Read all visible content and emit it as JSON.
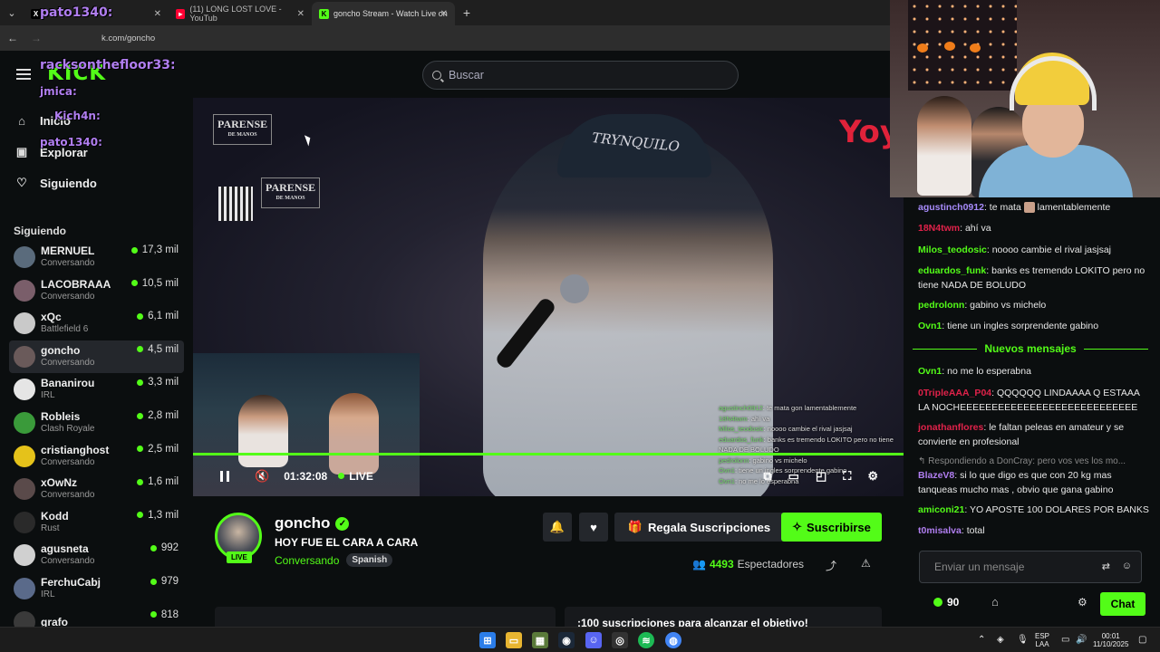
{
  "browser": {
    "tabs": [
      {
        "title": "",
        "favicon": "x-icon"
      },
      {
        "title": "(11) LONG LOST LOVE - YouTub",
        "favicon": "youtube-icon"
      },
      {
        "title": "goncho Stream - Watch Live on",
        "favicon": "kick-icon"
      }
    ],
    "url": "k.com/goncho"
  },
  "site": {
    "logo": "KICK",
    "search_placeholder": "Buscar"
  },
  "nav": {
    "home": "Inicio",
    "explore": "Explorar",
    "following": "Siguiendo"
  },
  "following_section": "Siguiendo",
  "channels": [
    {
      "name": "MERNUEL",
      "category": "Conversando",
      "viewers": "17,3 mil",
      "avatar_color": "#5a6b7c"
    },
    {
      "name": "LACOBRAAA",
      "category": "Conversando",
      "viewers": "10,5 mil",
      "avatar_color": "#7a5e6a"
    },
    {
      "name": "xQc",
      "category": "Battlefield 6",
      "viewers": "6,1 mil",
      "avatar_color": "#c9c9c9"
    },
    {
      "name": "goncho",
      "category": "Conversando",
      "viewers": "4,5 mil",
      "avatar_color": "#6a5a5a"
    },
    {
      "name": "Bananirou",
      "category": "IRL",
      "viewers": "3,3 mil",
      "avatar_color": "#e5e5e5"
    },
    {
      "name": "Robleis",
      "category": "Clash Royale",
      "viewers": "2,8 mil",
      "avatar_color": "#3a9a3a"
    },
    {
      "name": "cristianghost",
      "category": "Conversando",
      "viewers": "2,5 mil",
      "avatar_color": "#e5c21a"
    },
    {
      "name": "xOwNz",
      "category": "Conversando",
      "viewers": "1,6 mil",
      "avatar_color": "#5a4a4a"
    },
    {
      "name": "Kodd",
      "category": "Rust",
      "viewers": "1,3 mil",
      "avatar_color": "#2a2a2a"
    },
    {
      "name": "agusneta",
      "category": "Conversando",
      "viewers": "992",
      "avatar_color": "#d0d0d0"
    },
    {
      "name": "FerchuCabj",
      "category": "IRL",
      "viewers": "979",
      "avatar_color": "#5a6a8a"
    },
    {
      "name": "grafo",
      "category": "",
      "viewers": "818",
      "avatar_color": "#3a3a3a"
    }
  ],
  "video": {
    "time": "01:32:08",
    "live_label": "LIVE",
    "overlay_text": [
      "PARENSE",
      "DE MANOS"
    ],
    "cap_text": "TRYNQUILO",
    "brand": "Yoy",
    "overlay_chat": [
      {
        "user": "agustinch0912",
        "text": ": te mata gon lamentablemente"
      },
      {
        "user": "18N4twm",
        "text": ": ahí va"
      },
      {
        "user": "Milos_teodosic",
        "text": ": noooo cambie el rival jasjsaj"
      },
      {
        "user": "eduardos_funk",
        "text": ": banks es tremendo LOKITO pero no tiene NADA DE BOLUDO"
      },
      {
        "user": "pedrolonn",
        "text": ": gabino vs michelo"
      },
      {
        "user": "Ovn1",
        "text": ": tiene un ingles sorprendente gabino"
      },
      {
        "user": "Ovn1",
        "text": ": no me lo esperabna"
      }
    ]
  },
  "stream": {
    "name": "goncho",
    "title": "HOY FUE EL CARA A CARA",
    "category": "Conversando",
    "language": "Spanish",
    "live_badge": "LIVE",
    "viewers": "4493",
    "viewers_label": "Espectadores",
    "gift_button": "Regala Suscripciones",
    "subscribe_button": "Suscribirse",
    "goal_text": ":100 suscripciones para alcanzar el objetivo!"
  },
  "chat": {
    "messages": [
      {
        "user": "agustinch0912",
        "color": "#a78bfa",
        "text": "te mata",
        "text2": "lamentablemente"
      },
      {
        "user": "18N4twm",
        "color": "#e0224a",
        "text": "ahí va"
      },
      {
        "user": "Milos_teodosic",
        "color": "#53fc18",
        "text": "noooo cambie el rival jasjsaj"
      },
      {
        "user": "eduardos_funk",
        "color": "#53fc18",
        "text": "banks es tremendo LOKITO pero no tiene NADA DE BOLUDO"
      },
      {
        "user": "pedrolonn",
        "color": "#53fc18",
        "text": "gabino vs michelo"
      },
      {
        "user": "Ovn1",
        "color": "#53fc18",
        "text": "tiene un ingles sorprendente gabino"
      }
    ],
    "new_messages_label": "Nuevos mensajes",
    "messages_after": [
      {
        "user": "Ovn1",
        "color": "#53fc18",
        "text": "no me lo esperabna"
      },
      {
        "user": "0TripleAAA_P04",
        "color": "#e0224a",
        "text": "QQQQQQ LINDAAAA Q ESTAAA LA NOCHEEEEEEEEEEEEEEEEEEEEEEEEEEEE"
      },
      {
        "user": "jonathanflores",
        "color": "#e0224a",
        "text": "le faltan peleas en amateur y se convierte en profesional"
      },
      {
        "user": "BlazeV8",
        "color": "#b07ef0",
        "text": "si lo que digo es que con 20 kg mas tanqueas mucho mas , obvio que gana gabino"
      },
      {
        "user": "amiconi21",
        "color": "#53fc18",
        "text": "YO APOSTE 100 DOLARES POR BANKS"
      },
      {
        "user": "t0misalva",
        "color": "#b07ef0",
        "text": "total"
      }
    ],
    "reply_hint": "Respondiendo a DonCray: pero vos ves los mo...",
    "input_placeholder": "Enviar un mensaje",
    "points": "90",
    "chat_button": "Chat"
  },
  "floating_chat": [
    {
      "user": "pato1340:"
    },
    {
      "user": "racksonthefloor33:"
    },
    {
      "user": "jmica:"
    },
    {
      "user": "Kich4n:"
    },
    {
      "user": "pato1340:"
    }
  ],
  "taskbar": {
    "lang": "ESP",
    "lang2": "LAA",
    "time": "00:01",
    "date": "11/10/2025"
  }
}
